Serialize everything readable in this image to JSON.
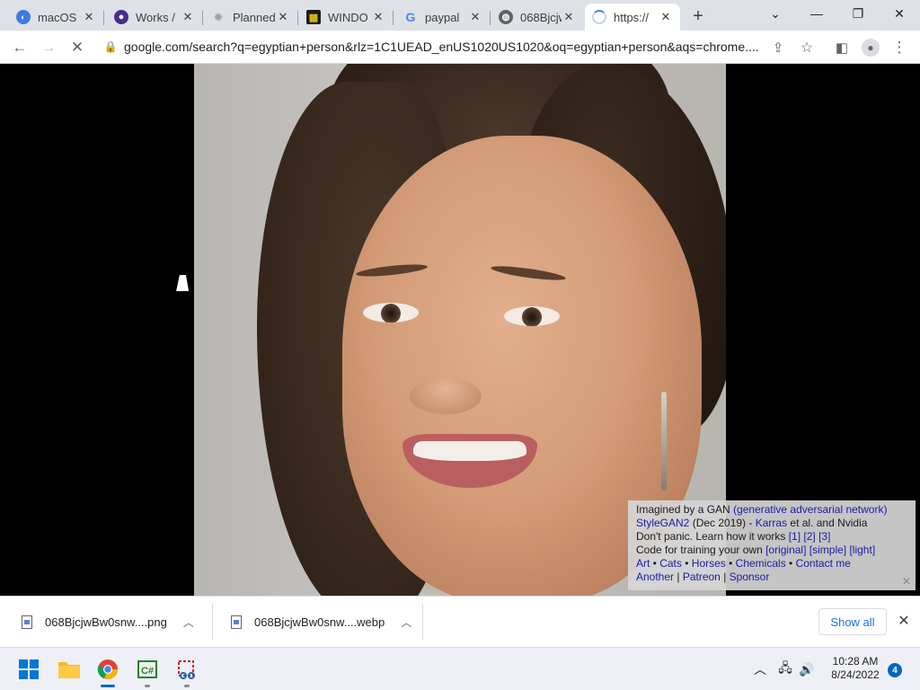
{
  "tabs": [
    {
      "title": "macOS",
      "icon": "macos-favicon-icon"
    },
    {
      "title": "Works /",
      "icon": "works-favicon-icon"
    },
    {
      "title": "Planned",
      "icon": "planned-favicon-icon"
    },
    {
      "title": "WINDO",
      "icon": "windows-favicon-icon"
    },
    {
      "title": "paypal",
      "icon": "google-favicon-icon"
    },
    {
      "title": "068Bjcjw",
      "icon": "globe-favicon-icon"
    },
    {
      "title": "https://",
      "icon": "loading-spinner-icon",
      "active": true
    }
  ],
  "address_bar": {
    "url": "google.com/search?q=egyptian+person&rlz=1C1UEAD_enUS1020US1020&oq=egyptian+person&aqs=chrome...."
  },
  "gan_overlay": {
    "line1_text": "Imagined by a GAN ",
    "line1_link": "(generative adversarial network)",
    "line2_link1": "StyleGAN2",
    "line2_text1": " (Dec 2019) - ",
    "line2_link2": "Karras",
    "line2_text2": " et al. and Nvidia",
    "line3_text": "Don't panic. Learn how it works ",
    "line3_links": [
      "[1]",
      "[2]",
      "[3]"
    ],
    "line4_text": "Code for training your own ",
    "line4_links": [
      "[original]",
      "[simple]",
      "[light]"
    ],
    "line5_links": [
      "Art",
      "Cats",
      "Horses",
      "Chemicals",
      "Contact me"
    ],
    "line6_links": [
      "Another",
      "Patreon",
      "Sponsor"
    ]
  },
  "downloads": [
    {
      "filename": "068BjcjwBw0snw....png"
    },
    {
      "filename": "068BjcjwBw0snw....webp"
    }
  ],
  "download_shelf": {
    "show_all_label": "Show all"
  },
  "taskbar": {
    "time": "10:28 AM",
    "date": "8/24/2022",
    "notification_count": "4"
  }
}
